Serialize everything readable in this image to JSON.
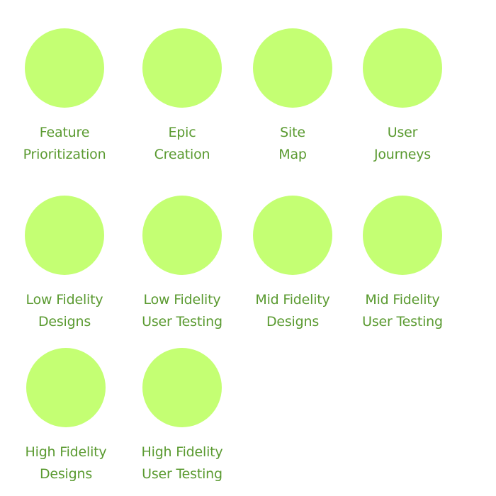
{
  "colors": {
    "circle": "#c4ff73",
    "label": "#5a9a30"
  },
  "steps": [
    {
      "icon": "circle-icon",
      "line1": "Feature",
      "line2": "Prioritization"
    },
    {
      "icon": "circle-icon",
      "line1": "Epic",
      "line2": "Creation"
    },
    {
      "icon": "circle-icon",
      "line1": "Site",
      "line2": "Map"
    },
    {
      "icon": "circle-icon",
      "line1": "User",
      "line2": "Journeys"
    },
    {
      "icon": "circle-icon",
      "line1": "Low Fidelity",
      "line2": "Designs"
    },
    {
      "icon": "circle-icon",
      "line1": "Low Fidelity",
      "line2": "User Testing"
    },
    {
      "icon": "circle-icon",
      "line1": "Mid Fidelity",
      "line2": "Designs"
    },
    {
      "icon": "circle-icon",
      "line1": "Mid Fidelity",
      "line2": "User Testing"
    },
    {
      "icon": "circle-icon",
      "line1": "High Fidelity",
      "line2": "Designs"
    },
    {
      "icon": "circle-icon",
      "line1": "High Fidelity",
      "line2": "User Testing"
    }
  ]
}
